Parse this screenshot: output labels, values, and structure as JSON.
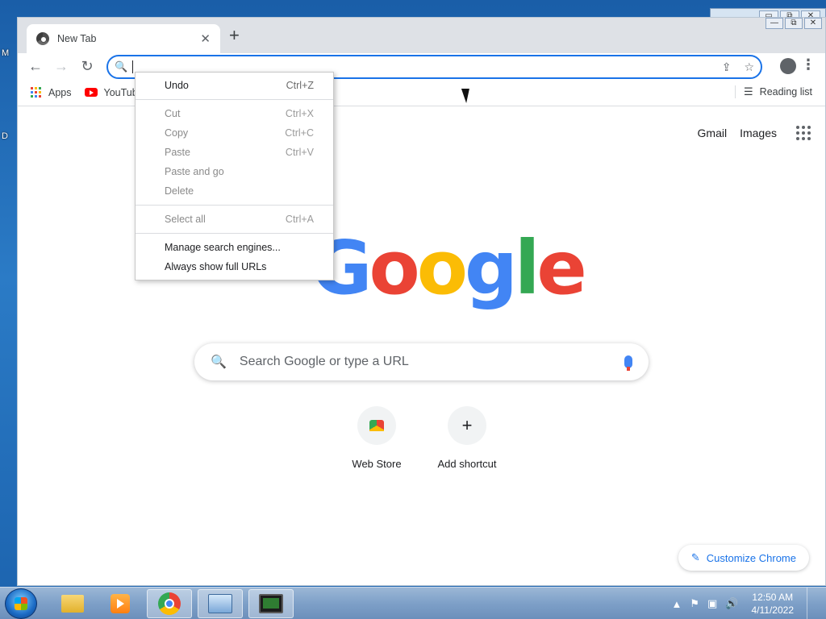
{
  "desktop": {
    "letters": [
      "M",
      "D"
    ]
  },
  "background_window": {
    "controls": [
      "▭",
      "⧉",
      "✕"
    ]
  },
  "window": {
    "controls": [
      "—",
      "⧉",
      "✕"
    ]
  },
  "tab": {
    "title": "New Tab",
    "close": "✕",
    "new_tab": "+"
  },
  "toolbar": {
    "back": "←",
    "forward": "→",
    "reload": "↻",
    "omnibox_value": "",
    "share": "⇪",
    "star": "☆",
    "menu": "⋮"
  },
  "bookmarks": {
    "items": [
      {
        "label": "Apps",
        "icon": "apps-grid-icon"
      },
      {
        "label": "YouTub",
        "icon": "youtube-icon"
      }
    ],
    "reading_list": "Reading list"
  },
  "ntp": {
    "links": [
      "Gmail",
      "Images"
    ],
    "logo_letters": [
      {
        "char": "G",
        "color": "#4285F4"
      },
      {
        "char": "o",
        "color": "#EA4335"
      },
      {
        "char": "o",
        "color": "#FBBC05"
      },
      {
        "char": "g",
        "color": "#4285F4"
      },
      {
        "char": "l",
        "color": "#34A853"
      },
      {
        "char": "e",
        "color": "#EA4335"
      }
    ],
    "search_placeholder": "Search Google or type a URL",
    "shortcuts": [
      {
        "label": "Web Store",
        "icon": "web-store-icon"
      },
      {
        "label": "Add shortcut",
        "icon": "plus-icon",
        "glyph": "+"
      }
    ],
    "customize": "Customize Chrome"
  },
  "context_menu": {
    "items": [
      {
        "label": "Undo",
        "shortcut": "Ctrl+Z",
        "enabled": true
      },
      {
        "label": "Cut",
        "shortcut": "Ctrl+X",
        "enabled": false
      },
      {
        "label": "Copy",
        "shortcut": "Ctrl+C",
        "enabled": false
      },
      {
        "label": "Paste",
        "shortcut": "Ctrl+V",
        "enabled": false
      },
      {
        "label": "Paste and go",
        "shortcut": "",
        "enabled": false
      },
      {
        "label": "Delete",
        "shortcut": "",
        "enabled": false
      },
      {
        "label": "Select all",
        "shortcut": "Ctrl+A",
        "enabled": false
      },
      {
        "label": "Manage search engines...",
        "shortcut": "",
        "enabled": true
      },
      {
        "label": "Always show full URLs",
        "shortcut": "",
        "enabled": true
      }
    ]
  },
  "taskbar": {
    "apps": [
      "file-explorer",
      "media-player",
      "chrome",
      "control-panel",
      "system-monitor"
    ],
    "active_app": "chrome",
    "tray": {
      "time": "12:50 AM",
      "date": "4/11/2022"
    }
  },
  "colors": {
    "accent": "#1a73e8",
    "tabstrip": "#dee1e6",
    "taskbar": "#7ea0c8"
  }
}
